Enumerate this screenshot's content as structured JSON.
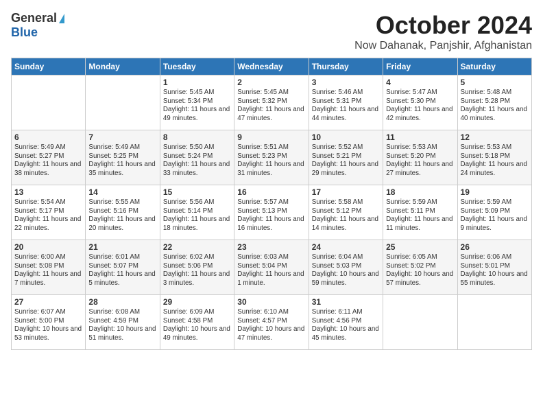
{
  "header": {
    "logo_general": "General",
    "logo_blue": "Blue",
    "month": "October 2024",
    "location": "Now Dahanak, Panjshir, Afghanistan"
  },
  "weekdays": [
    "Sunday",
    "Monday",
    "Tuesday",
    "Wednesday",
    "Thursday",
    "Friday",
    "Saturday"
  ],
  "weeks": [
    [
      {
        "day": "",
        "content": ""
      },
      {
        "day": "",
        "content": ""
      },
      {
        "day": "1",
        "content": "Sunrise: 5:45 AM\nSunset: 5:34 PM\nDaylight: 11 hours and 49 minutes."
      },
      {
        "day": "2",
        "content": "Sunrise: 5:45 AM\nSunset: 5:32 PM\nDaylight: 11 hours and 47 minutes."
      },
      {
        "day": "3",
        "content": "Sunrise: 5:46 AM\nSunset: 5:31 PM\nDaylight: 11 hours and 44 minutes."
      },
      {
        "day": "4",
        "content": "Sunrise: 5:47 AM\nSunset: 5:30 PM\nDaylight: 11 hours and 42 minutes."
      },
      {
        "day": "5",
        "content": "Sunrise: 5:48 AM\nSunset: 5:28 PM\nDaylight: 11 hours and 40 minutes."
      }
    ],
    [
      {
        "day": "6",
        "content": "Sunrise: 5:49 AM\nSunset: 5:27 PM\nDaylight: 11 hours and 38 minutes."
      },
      {
        "day": "7",
        "content": "Sunrise: 5:49 AM\nSunset: 5:25 PM\nDaylight: 11 hours and 35 minutes."
      },
      {
        "day": "8",
        "content": "Sunrise: 5:50 AM\nSunset: 5:24 PM\nDaylight: 11 hours and 33 minutes."
      },
      {
        "day": "9",
        "content": "Sunrise: 5:51 AM\nSunset: 5:23 PM\nDaylight: 11 hours and 31 minutes."
      },
      {
        "day": "10",
        "content": "Sunrise: 5:52 AM\nSunset: 5:21 PM\nDaylight: 11 hours and 29 minutes."
      },
      {
        "day": "11",
        "content": "Sunrise: 5:53 AM\nSunset: 5:20 PM\nDaylight: 11 hours and 27 minutes."
      },
      {
        "day": "12",
        "content": "Sunrise: 5:53 AM\nSunset: 5:18 PM\nDaylight: 11 hours and 24 minutes."
      }
    ],
    [
      {
        "day": "13",
        "content": "Sunrise: 5:54 AM\nSunset: 5:17 PM\nDaylight: 11 hours and 22 minutes."
      },
      {
        "day": "14",
        "content": "Sunrise: 5:55 AM\nSunset: 5:16 PM\nDaylight: 11 hours and 20 minutes."
      },
      {
        "day": "15",
        "content": "Sunrise: 5:56 AM\nSunset: 5:14 PM\nDaylight: 11 hours and 18 minutes."
      },
      {
        "day": "16",
        "content": "Sunrise: 5:57 AM\nSunset: 5:13 PM\nDaylight: 11 hours and 16 minutes."
      },
      {
        "day": "17",
        "content": "Sunrise: 5:58 AM\nSunset: 5:12 PM\nDaylight: 11 hours and 14 minutes."
      },
      {
        "day": "18",
        "content": "Sunrise: 5:59 AM\nSunset: 5:11 PM\nDaylight: 11 hours and 11 minutes."
      },
      {
        "day": "19",
        "content": "Sunrise: 5:59 AM\nSunset: 5:09 PM\nDaylight: 11 hours and 9 minutes."
      }
    ],
    [
      {
        "day": "20",
        "content": "Sunrise: 6:00 AM\nSunset: 5:08 PM\nDaylight: 11 hours and 7 minutes."
      },
      {
        "day": "21",
        "content": "Sunrise: 6:01 AM\nSunset: 5:07 PM\nDaylight: 11 hours and 5 minutes."
      },
      {
        "day": "22",
        "content": "Sunrise: 6:02 AM\nSunset: 5:06 PM\nDaylight: 11 hours and 3 minutes."
      },
      {
        "day": "23",
        "content": "Sunrise: 6:03 AM\nSunset: 5:04 PM\nDaylight: 11 hours and 1 minute."
      },
      {
        "day": "24",
        "content": "Sunrise: 6:04 AM\nSunset: 5:03 PM\nDaylight: 10 hours and 59 minutes."
      },
      {
        "day": "25",
        "content": "Sunrise: 6:05 AM\nSunset: 5:02 PM\nDaylight: 10 hours and 57 minutes."
      },
      {
        "day": "26",
        "content": "Sunrise: 6:06 AM\nSunset: 5:01 PM\nDaylight: 10 hours and 55 minutes."
      }
    ],
    [
      {
        "day": "27",
        "content": "Sunrise: 6:07 AM\nSunset: 5:00 PM\nDaylight: 10 hours and 53 minutes."
      },
      {
        "day": "28",
        "content": "Sunrise: 6:08 AM\nSunset: 4:59 PM\nDaylight: 10 hours and 51 minutes."
      },
      {
        "day": "29",
        "content": "Sunrise: 6:09 AM\nSunset: 4:58 PM\nDaylight: 10 hours and 49 minutes."
      },
      {
        "day": "30",
        "content": "Sunrise: 6:10 AM\nSunset: 4:57 PM\nDaylight: 10 hours and 47 minutes."
      },
      {
        "day": "31",
        "content": "Sunrise: 6:11 AM\nSunset: 4:56 PM\nDaylight: 10 hours and 45 minutes."
      },
      {
        "day": "",
        "content": ""
      },
      {
        "day": "",
        "content": ""
      }
    ]
  ]
}
